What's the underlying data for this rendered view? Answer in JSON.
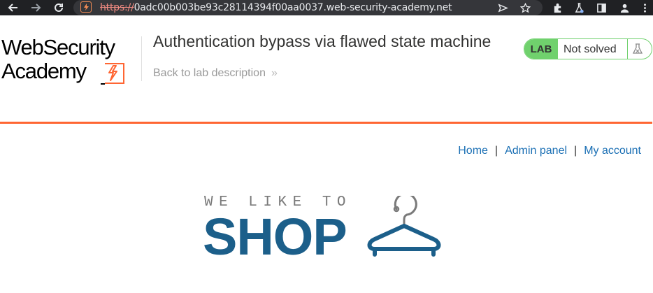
{
  "browser": {
    "url_scheme": "https://",
    "url_host": "0adc00b003be93c28114394f00aa0037.web-security-academy.net",
    "icons": [
      "back-arrow-icon",
      "forward-arrow-icon",
      "reload-icon",
      "site-icon",
      "send-icon",
      "star-icon",
      "extensions-icon",
      "lab-flask-icon",
      "sidebar-icon",
      "profile-icon",
      "menu-icon"
    ]
  },
  "lab_header": {
    "logo_line1": "WebSecurity",
    "logo_line2": "Academy",
    "title": "Authentication bypass via flawed state machine",
    "back_link": "Back to lab description",
    "back_chevron": "»",
    "status_badge": "LAB",
    "status_text": "Not solved"
  },
  "shop_nav": {
    "home": "Home",
    "admin": "Admin panel",
    "account": "My account",
    "separator": "|"
  },
  "shop_logo": {
    "tagline": "WE LIKE TO",
    "word": "SHOP"
  },
  "colors": {
    "accent_orange": "#ff6633",
    "lab_green": "#70d16d",
    "link_blue": "#1a6fb4",
    "shop_blue": "#1c5f8a"
  }
}
